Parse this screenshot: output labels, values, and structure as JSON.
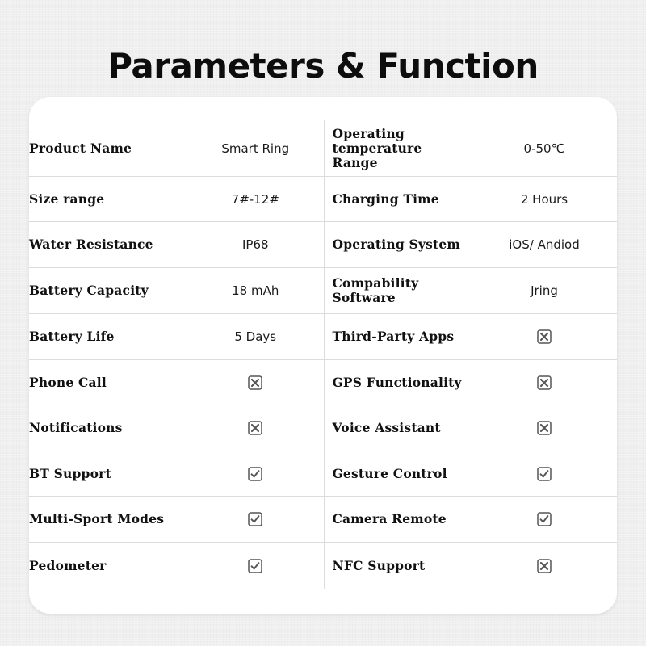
{
  "header": {
    "title": "Parameters & Function"
  },
  "icons": {
    "supported": "checkbox-checked-icon",
    "unsupported": "checkbox-x-icon"
  },
  "colors": {
    "background": "#efefef",
    "card": "#ffffff",
    "divider": "#dcdcdc",
    "label_text": "#111111",
    "icon_stroke": "#555555"
  },
  "rows": [
    {
      "left": {
        "label": "Product Name",
        "type": "text",
        "value": "Smart Ring"
      },
      "right": {
        "label": "Operating temperature Range",
        "type": "text",
        "value": "0-50℃"
      }
    },
    {
      "left": {
        "label": "Size range",
        "type": "text",
        "value": "7#-12#"
      },
      "right": {
        "label": "Charging Time",
        "type": "text",
        "value": "2 Hours"
      }
    },
    {
      "left": {
        "label": "Water Resistance",
        "type": "text",
        "value": "IP68"
      },
      "right": {
        "label": "Operating System",
        "type": "text",
        "value": "iOS/ Andiod"
      }
    },
    {
      "left": {
        "label": "Battery Capacity",
        "type": "text",
        "value": "18 mAh"
      },
      "right": {
        "label": "Compability Software",
        "type": "text",
        "value": "Jring"
      }
    },
    {
      "left": {
        "label": "Battery Life",
        "type": "text",
        "value": "5 Days"
      },
      "right": {
        "label": "Third-Party Apps",
        "type": "status",
        "value": "unsupported"
      }
    },
    {
      "left": {
        "label": "Phone Call",
        "type": "status",
        "value": "unsupported"
      },
      "right": {
        "label": "GPS Functionality",
        "type": "status",
        "value": "unsupported"
      }
    },
    {
      "left": {
        "label": "Notifications",
        "type": "status",
        "value": "unsupported"
      },
      "right": {
        "label": "Voice Assistant",
        "type": "status",
        "value": "unsupported"
      }
    },
    {
      "left": {
        "label": "BT Support",
        "type": "status",
        "value": "supported"
      },
      "right": {
        "label": "Gesture Control",
        "type": "status",
        "value": "supported"
      }
    },
    {
      "left": {
        "label": "Multi-Sport Modes",
        "type": "status",
        "value": "supported"
      },
      "right": {
        "label": "Camera Remote",
        "type": "status",
        "value": "supported"
      }
    },
    {
      "left": {
        "label": "Pedometer",
        "type": "status",
        "value": "supported"
      },
      "right": {
        "label": "NFC Support",
        "type": "status",
        "value": "unsupported"
      }
    }
  ]
}
